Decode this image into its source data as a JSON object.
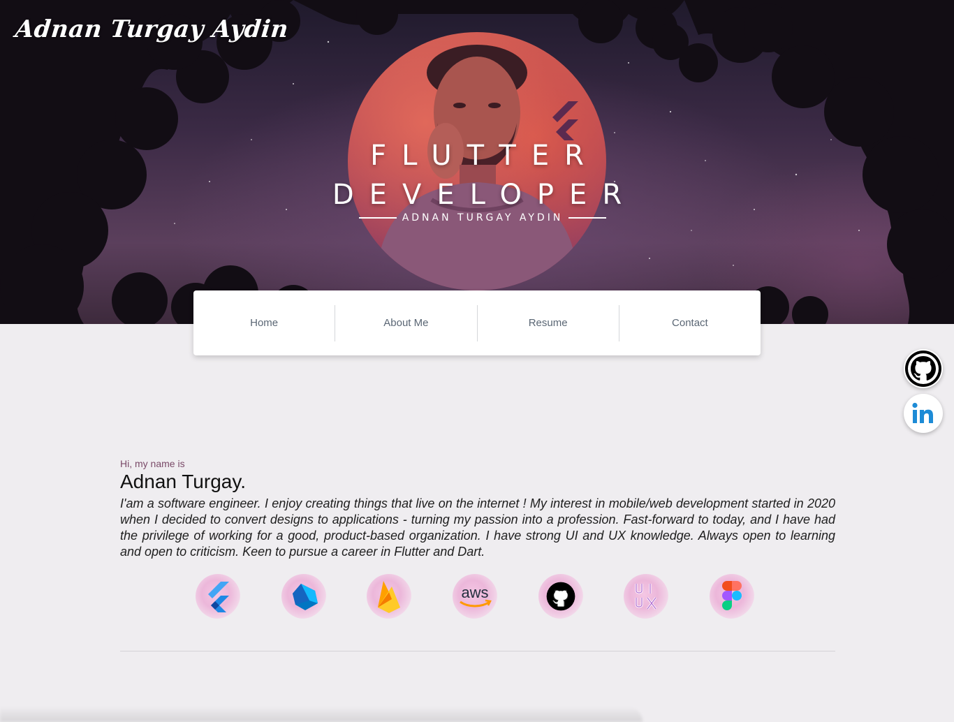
{
  "header": {
    "brand": "Adnan Turgay Aydin"
  },
  "hero": {
    "title_line1": "FLUTTER",
    "title_line2": "DEVELOPER",
    "subtitle": "ADNAN TURGAY AYDIN"
  },
  "nav": {
    "items": [
      {
        "label": "Home"
      },
      {
        "label": "About Me"
      },
      {
        "label": "Resume"
      },
      {
        "label": "Contact"
      }
    ]
  },
  "social": [
    {
      "icon": "github-icon"
    },
    {
      "icon": "linkedin-icon"
    }
  ],
  "about": {
    "greeting": "Hi, my name is",
    "name": "Adnan Turgay.",
    "bio": "I'am a software engineer. I enjoy creating things that live on the internet ! My interest in mobile/web development started in 2020 when I decided to convert designs to applications - turning my passion into a profession. Fast-forward to today, and I have had the privilege of working for a good, product-based organization. I have strong UI and UX knowledge. Always open to learning and open to criticism. Keen to pursue a career in Flutter and Dart."
  },
  "skills": [
    {
      "icon": "flutter-icon"
    },
    {
      "icon": "dart-icon"
    },
    {
      "icon": "firebase-icon"
    },
    {
      "icon": "aws-icon",
      "label": "aws"
    },
    {
      "icon": "github-icon"
    },
    {
      "icon": "ui-ux-icon"
    },
    {
      "icon": "figma-icon"
    }
  ],
  "colors": {
    "accent": "#7a4a68",
    "nav_text": "#5a6674",
    "background": "#efedf0",
    "linkedin": "#1d8bd6"
  }
}
